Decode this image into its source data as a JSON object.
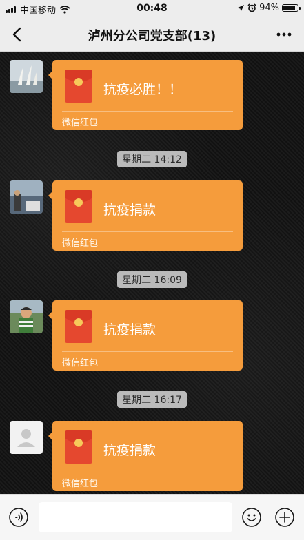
{
  "status_bar": {
    "carrier": "中国移动",
    "time": "00:48",
    "battery": "94%",
    "battery_level": 0.94
  },
  "header": {
    "title": "泸州分公司党支部(13)",
    "back_icon": "back-chevron-icon",
    "more_icon": "more-dots-icon"
  },
  "messages": [
    {
      "greeting": "抗疫必胜！！",
      "label": "微信红包",
      "avatar": "avatar-sails"
    },
    {
      "time": "星期二 14:12",
      "greeting": "抗疫捐款",
      "label": "微信红包",
      "avatar": "avatar-lake"
    },
    {
      "time": "星期二 16:09",
      "greeting": "抗疫捐款",
      "label": "微信红包",
      "avatar": "avatar-child"
    },
    {
      "time": "星期二 16:17",
      "greeting": "抗疫捐款",
      "label": "微信红包",
      "avatar": "avatar-default"
    }
  ],
  "input_bar": {
    "text": "",
    "voice_icon": "voice-icon",
    "emoji_icon": "emoji-icon",
    "plus_icon": "plus-icon"
  },
  "colors": {
    "red_packet": "#f59c3c",
    "envelope": "#e5482f",
    "nav_background": "#ededed"
  }
}
